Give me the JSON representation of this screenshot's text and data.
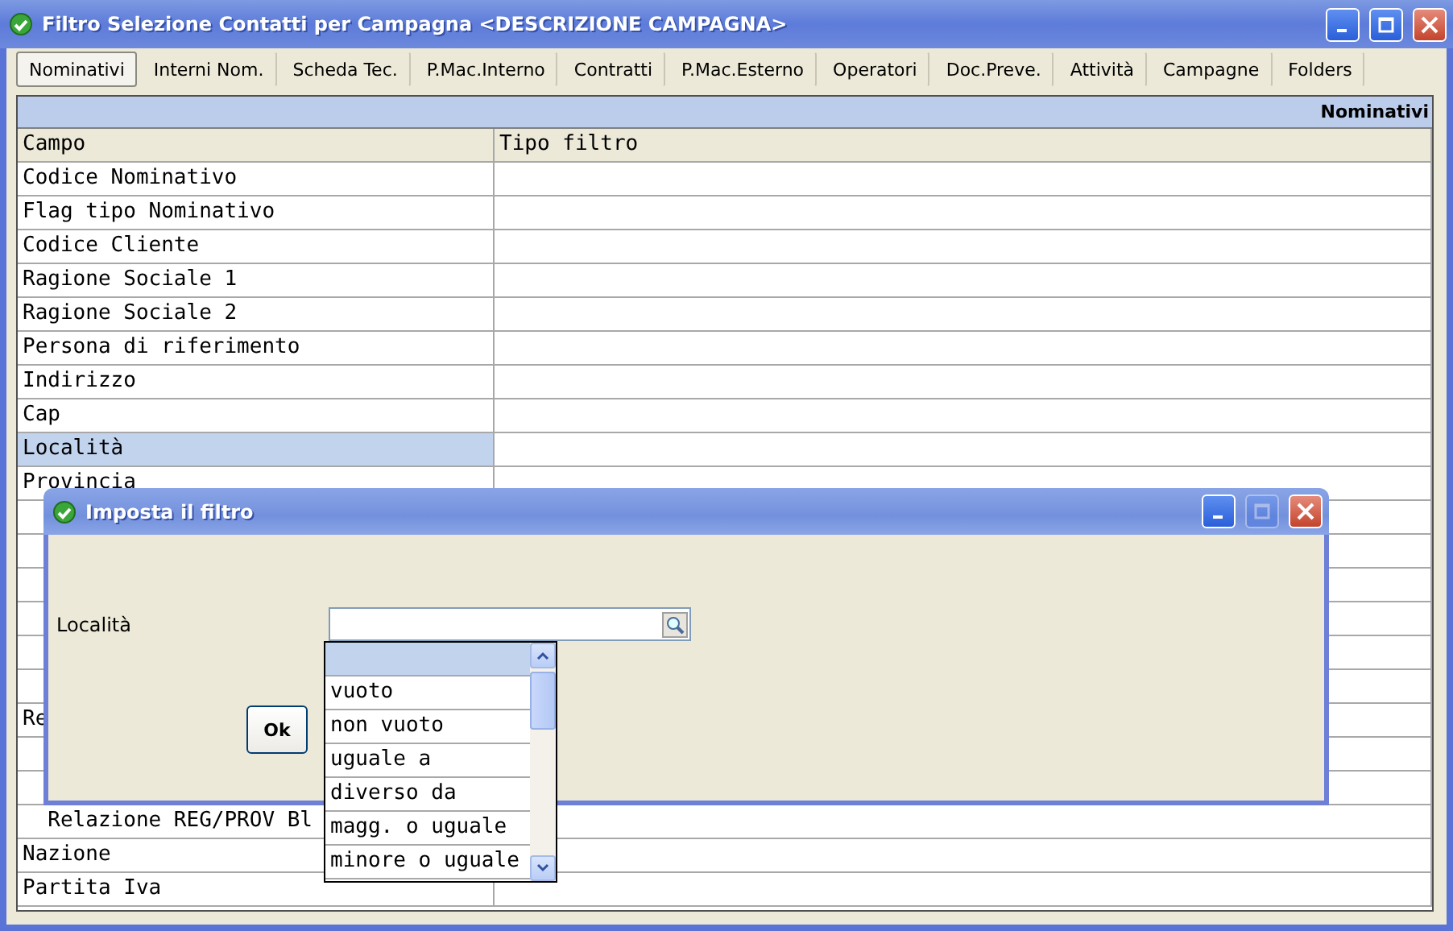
{
  "window": {
    "title": "Filtro Selezione Contatti per Campagna <DESCRIZIONE CAMPAGNA>",
    "controls": [
      {
        "kind": "minimize",
        "disabled": false
      },
      {
        "kind": "maximize",
        "disabled": false
      },
      {
        "kind": "close",
        "disabled": false
      }
    ]
  },
  "tabs": [
    {
      "label": "Nominativi",
      "selected": true
    },
    {
      "label": "Interni Nom.",
      "selected": false
    },
    {
      "label": "Scheda Tec.",
      "selected": false
    },
    {
      "label": "P.Mac.Interno",
      "selected": false
    },
    {
      "label": "Contratti",
      "selected": false
    },
    {
      "label": "P.Mac.Esterno",
      "selected": false
    },
    {
      "label": "Operatori",
      "selected": false
    },
    {
      "label": "Doc.Preve.",
      "selected": false
    },
    {
      "label": "Attività",
      "selected": false
    },
    {
      "label": "Campagne",
      "selected": false
    },
    {
      "label": "Folders",
      "selected": false
    }
  ],
  "grid": {
    "header_title": "Nominativi",
    "columns": [
      "Campo",
      "Tipo filtro"
    ],
    "rows": [
      {
        "kind": "field",
        "label": "Codice Nominativo",
        "selected": false
      },
      {
        "kind": "field",
        "label": "Flag tipo Nominativo",
        "selected": false
      },
      {
        "kind": "field",
        "label": "Codice Cliente",
        "selected": false
      },
      {
        "kind": "field",
        "label": "Ragione Sociale 1",
        "selected": false
      },
      {
        "kind": "field",
        "label": "Ragione Sociale 2",
        "selected": false
      },
      {
        "kind": "field",
        "label": "Persona di riferimento",
        "selected": false
      },
      {
        "kind": "field",
        "label": "Indirizzo",
        "selected": false
      },
      {
        "kind": "field",
        "label": "Cap",
        "selected": false
      },
      {
        "kind": "field",
        "label": "Località",
        "selected": true
      },
      {
        "kind": "field",
        "label": "Provincia",
        "selected": false
      },
      {
        "kind": "covered"
      },
      {
        "kind": "covered"
      },
      {
        "kind": "covered"
      },
      {
        "kind": "covered"
      },
      {
        "kind": "covered"
      },
      {
        "kind": "covered"
      },
      {
        "kind": "field",
        "label": "Re",
        "selected": false
      },
      {
        "kind": "covered"
      },
      {
        "kind": "covered"
      },
      {
        "kind": "field",
        "label": "  Relazione REG/PROV Bl",
        "selected": false
      },
      {
        "kind": "field",
        "label": "Nazione",
        "selected": false
      },
      {
        "kind": "field",
        "label": "Partita Iva",
        "selected": false
      }
    ]
  },
  "dialog": {
    "title": "Imposta il filtro",
    "controls": [
      {
        "kind": "minimize",
        "disabled": false
      },
      {
        "kind": "maximize",
        "disabled": true
      },
      {
        "kind": "close",
        "disabled": false
      }
    ],
    "field_label": "Località",
    "buttons": [
      "Ok"
    ],
    "options": [
      {
        "selected": true
      },
      {
        "label": "vuoto",
        "selected": false
      },
      {
        "label": "non vuoto",
        "selected": false
      },
      {
        "label": "uguale a",
        "selected": false
      },
      {
        "label": "diverso da",
        "selected": false
      },
      {
        "label": "magg. o uguale",
        "selected": false
      },
      {
        "label": "minore o uguale",
        "selected": false
      }
    ]
  }
}
